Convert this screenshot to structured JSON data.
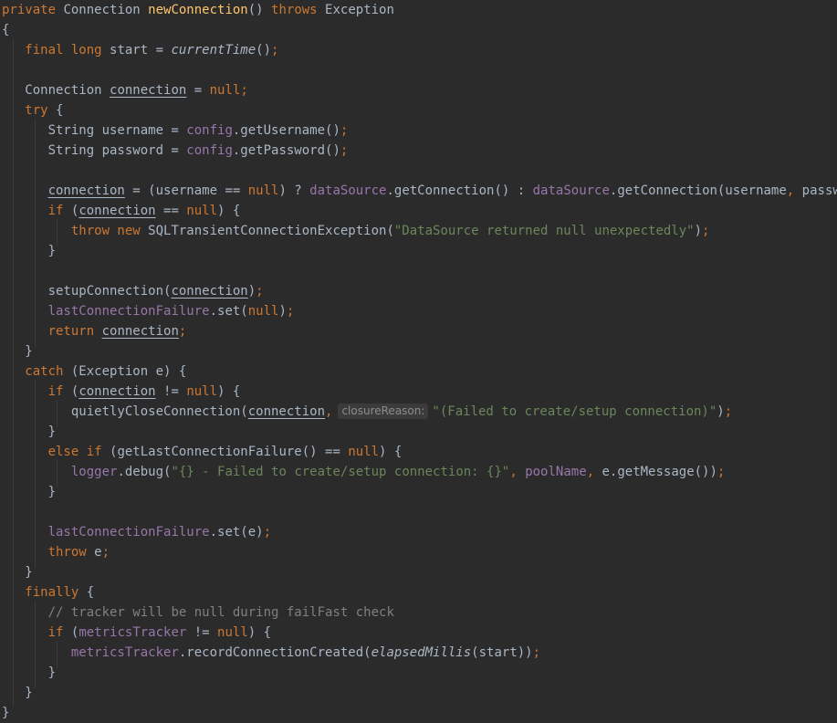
{
  "editor": {
    "lines": [
      [
        [
          "kw",
          "private "
        ],
        [
          "",
          "Connection "
        ],
        [
          "fn",
          "newConnection"
        ],
        [
          "",
          "() "
        ],
        [
          "kw",
          "throws "
        ],
        [
          "",
          "Exception"
        ]
      ],
      [
        [
          "",
          "{"
        ]
      ],
      [
        [
          "",
          "   "
        ],
        [
          "kw",
          "final long "
        ],
        [
          "",
          "start = "
        ],
        [
          "it",
          "currentTime"
        ],
        [
          "",
          "()"
        ],
        [
          "kw",
          ";"
        ]
      ],
      [],
      [
        [
          "",
          "   Connection "
        ],
        [
          "var",
          "connection"
        ],
        [
          "",
          " = "
        ],
        [
          "kw",
          "null;"
        ]
      ],
      [
        [
          "",
          "   "
        ],
        [
          "kw",
          "try "
        ],
        [
          "",
          "{"
        ]
      ],
      [
        [
          "",
          "      String username = "
        ],
        [
          "fld",
          "config"
        ],
        [
          "",
          ".getUsername()"
        ],
        [
          "kw",
          ";"
        ]
      ],
      [
        [
          "",
          "      String password = "
        ],
        [
          "fld",
          "config"
        ],
        [
          "",
          ".getPassword()"
        ],
        [
          "kw",
          ";"
        ]
      ],
      [],
      [
        [
          "",
          "      "
        ],
        [
          "var",
          "connection"
        ],
        [
          "",
          " = (username == "
        ],
        [
          "kw",
          "null"
        ],
        [
          "",
          ") ? "
        ],
        [
          "fld",
          "dataSource"
        ],
        [
          "",
          ".getConnection() : "
        ],
        [
          "fld",
          "dataSource"
        ],
        [
          "",
          ".getConnection(username"
        ],
        [
          "kw",
          ", "
        ],
        [
          "",
          "password)"
        ],
        [
          "kw",
          ";"
        ]
      ],
      [
        [
          "",
          "      "
        ],
        [
          "kw",
          "if "
        ],
        [
          "",
          "("
        ],
        [
          "var",
          "connection"
        ],
        [
          "",
          " == "
        ],
        [
          "kw",
          "null"
        ],
        [
          "",
          ") {"
        ]
      ],
      [
        [
          "",
          "         "
        ],
        [
          "kw",
          "throw new "
        ],
        [
          "",
          "SQLTransientConnectionException("
        ],
        [
          "str",
          "\"DataSource returned null unexpectedly\""
        ],
        [
          "",
          ")"
        ],
        [
          "kw",
          ";"
        ]
      ],
      [
        [
          "",
          "      }"
        ]
      ],
      [],
      [
        [
          "",
          "      setupConnection("
        ],
        [
          "var",
          "connection"
        ],
        [
          "",
          ")"
        ],
        [
          "kw",
          ";"
        ]
      ],
      [
        [
          "",
          "      "
        ],
        [
          "fld",
          "lastConnectionFailure"
        ],
        [
          "",
          ".set("
        ],
        [
          "kw",
          "null"
        ],
        [
          "",
          ")"
        ],
        [
          "kw",
          ";"
        ]
      ],
      [
        [
          "",
          "      "
        ],
        [
          "kw",
          "return "
        ],
        [
          "var",
          "connection"
        ],
        [
          "kw",
          ";"
        ]
      ],
      [
        [
          "",
          "   }"
        ]
      ],
      [
        [
          "",
          "   "
        ],
        [
          "kw",
          "catch "
        ],
        [
          "",
          "(Exception e) {"
        ]
      ],
      [
        [
          "",
          "      "
        ],
        [
          "kw",
          "if "
        ],
        [
          "",
          "("
        ],
        [
          "var",
          "connection"
        ],
        [
          "",
          " != "
        ],
        [
          "kw",
          "null"
        ],
        [
          "",
          ") {"
        ]
      ],
      [
        [
          "",
          "         quietlyCloseConnection("
        ],
        [
          "var",
          "connection"
        ],
        [
          "kw",
          ","
        ],
        [
          "hint",
          "closureReason:"
        ],
        [
          "str",
          "\"(Failed to create/setup connection)\""
        ],
        [
          "",
          ")"
        ],
        [
          "kw",
          ";"
        ]
      ],
      [
        [
          "",
          "      }"
        ]
      ],
      [
        [
          "",
          "      "
        ],
        [
          "kw",
          "else if "
        ],
        [
          "",
          "(getLastConnectionFailure() == "
        ],
        [
          "kw",
          "null"
        ],
        [
          "",
          ") {"
        ]
      ],
      [
        [
          "",
          "         "
        ],
        [
          "fld",
          "logger"
        ],
        [
          "",
          ".debug("
        ],
        [
          "str",
          "\"{} - Failed to create/setup connection: {}\""
        ],
        [
          "kw",
          ", "
        ],
        [
          "fld",
          "poolName"
        ],
        [
          "kw",
          ", "
        ],
        [
          "",
          "e.getMessage())"
        ],
        [
          "kw",
          ";"
        ]
      ],
      [
        [
          "",
          "      }"
        ]
      ],
      [],
      [
        [
          "",
          "      "
        ],
        [
          "fld",
          "lastConnectionFailure"
        ],
        [
          "",
          ".set(e)"
        ],
        [
          "kw",
          ";"
        ]
      ],
      [
        [
          "",
          "      "
        ],
        [
          "kw",
          "throw "
        ],
        [
          "",
          "e"
        ],
        [
          "kw",
          ";"
        ]
      ],
      [
        [
          "",
          "   }"
        ]
      ],
      [
        [
          "",
          "   "
        ],
        [
          "kw",
          "finally "
        ],
        [
          "",
          "{"
        ]
      ],
      [
        [
          "",
          "      "
        ],
        [
          "cmt",
          "// tracker will be null during failFast check"
        ]
      ],
      [
        [
          "",
          "      "
        ],
        [
          "kw",
          "if "
        ],
        [
          "",
          "("
        ],
        [
          "fld",
          "metricsTracker"
        ],
        [
          "",
          " != "
        ],
        [
          "kw",
          "null"
        ],
        [
          "",
          ") {"
        ]
      ],
      [
        [
          "",
          "         "
        ],
        [
          "fld",
          "metricsTracker"
        ],
        [
          "",
          ".recordConnectionCreated("
        ],
        [
          "it",
          "elapsedMillis"
        ],
        [
          "",
          "(start))"
        ],
        [
          "kw",
          ";"
        ]
      ],
      [
        [
          "",
          "      }"
        ]
      ],
      [
        [
          "",
          "   }"
        ]
      ],
      [
        [
          "",
          "}"
        ]
      ]
    ]
  }
}
